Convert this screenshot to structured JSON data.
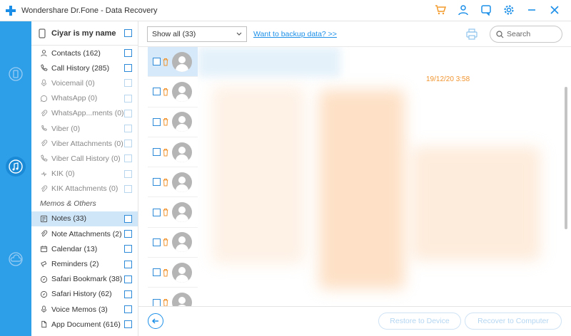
{
  "window": {
    "title": "Wondershare Dr.Fone - Data Recovery"
  },
  "titlebar_icons": [
    "cart-icon",
    "user-icon",
    "feedback-icon",
    "settings-icon",
    "minimize-icon",
    "close-icon"
  ],
  "rail": {
    "modes": [
      "recover-from-device-icon",
      "recover-from-itunes-icon",
      "recover-from-icloud-icon"
    ],
    "active": 1
  },
  "device": {
    "name": "Ciyar is my name"
  },
  "categories": [
    {
      "label": "Contacts (162)",
      "icon": "contact-icon",
      "enabled": true
    },
    {
      "label": "Call History (285)",
      "icon": "phone-icon",
      "enabled": true
    },
    {
      "label": "Voicemail (0)",
      "icon": "mic-icon",
      "enabled": false
    },
    {
      "label": "WhatsApp (0)",
      "icon": "whatsapp-icon",
      "enabled": false
    },
    {
      "label": "WhatsApp...ments (0)",
      "icon": "attachment-icon",
      "enabled": false
    },
    {
      "label": "Viber (0)",
      "icon": "viber-icon",
      "enabled": false
    },
    {
      "label": "Viber Attachments (0)",
      "icon": "attachment-icon",
      "enabled": false
    },
    {
      "label": "Viber Call History (0)",
      "icon": "phone-icon",
      "enabled": false
    },
    {
      "label": "KIK (0)",
      "icon": "kik-icon",
      "enabled": false
    },
    {
      "label": "KIK Attachments (0)",
      "icon": "attachment-icon",
      "enabled": false
    }
  ],
  "group_title": "Memos & Others",
  "memos": [
    {
      "label": "Notes (33)",
      "icon": "notes-icon",
      "selected": true
    },
    {
      "label": "Note Attachments (2)",
      "icon": "attachment-icon"
    },
    {
      "label": "Calendar (13)",
      "icon": "calendar-icon"
    },
    {
      "label": "Reminders (2)",
      "icon": "reminder-icon"
    },
    {
      "label": "Safari Bookmark (38)",
      "icon": "compass-icon"
    },
    {
      "label": "Safari History (62)",
      "icon": "compass-icon"
    },
    {
      "label": "Voice Memos (3)",
      "icon": "mic-icon"
    },
    {
      "label": "App Document (616)",
      "icon": "document-icon"
    }
  ],
  "toolbar": {
    "filter_value": "Show all (33)",
    "backup_link": "Want to backup data? >>",
    "search_placeholder": "Search"
  },
  "list": {
    "row_count": 9
  },
  "detail": {
    "date": "19/12/20 3:58"
  },
  "footer": {
    "restore_label": "Restore to Device",
    "recover_label": "Recover to Computer"
  },
  "colors": {
    "accent": "#2d9ee8",
    "link": "#1b8fe8",
    "date": "#f0932d",
    "cart": "#f39a2a"
  }
}
